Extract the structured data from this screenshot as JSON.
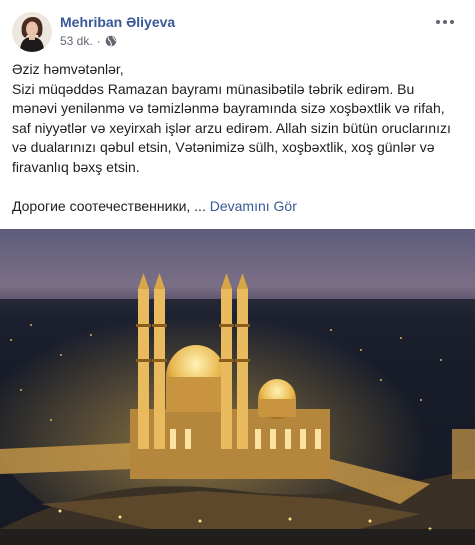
{
  "post": {
    "author": "Mehriban Əliyeva",
    "timestamp": "53 dk.",
    "separator": "·",
    "privacy_icon": "globe-icon",
    "options_icon": "more-options-icon",
    "text_lines": [
      "Əziz həmvətənlər,",
      "Sizi müqəddəs Ramazan bayramı münasibətilə təbrik edirəm. Bu",
      "mənəvi yenilənmə və təmizlənmə bayramında sizə xoşbəxtlik və rifah,",
      "saf niyyətlər və xeyirxah işlər arzu edirəm. Allah sizin bütün oruclarınızı",
      "və dualarınızı qəbul etsin, Vətənimizə sülh, xoşbəxtlik, xoş günlər və",
      "firavanlıq bəxş etsin."
    ],
    "russian_preview": "Дорогие соотечественники, ...",
    "see_more": "Devamını Gör"
  },
  "colors": {
    "link": "#385898",
    "meta": "#616770",
    "text": "#1c1e21"
  }
}
